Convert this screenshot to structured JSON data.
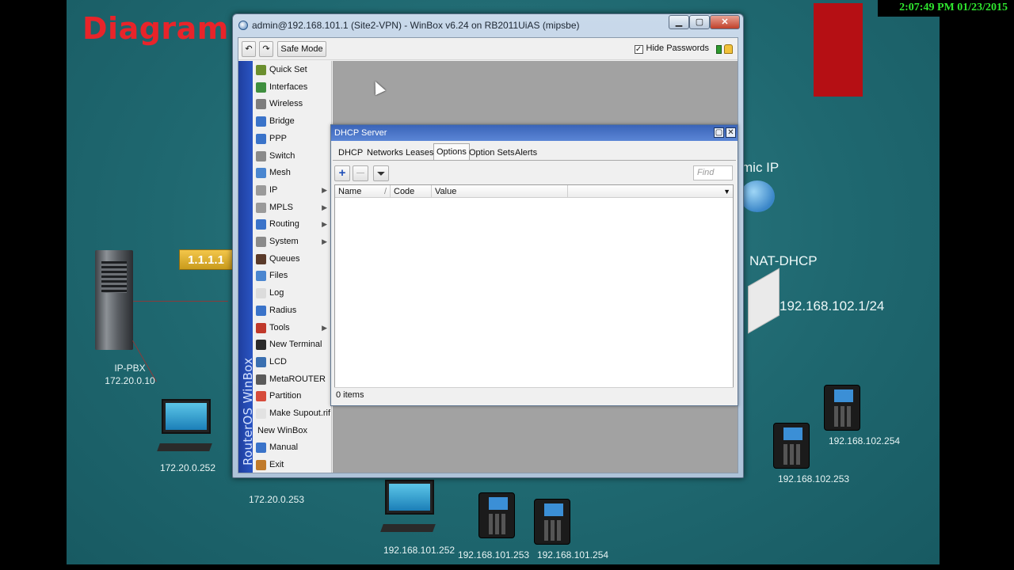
{
  "clock": "2:07:49 PM 01/23/2015",
  "diagram": {
    "title": "Diagram V",
    "ip_badge": "1.1.1.1",
    "server_label": "IP-PBX",
    "server_ip": "172.20.0.10",
    "pc1_ip": "172.20.0.252",
    "pc2_ip": "172.20.0.253",
    "pc3_ip": "192.168.101.252",
    "phone1_ip": "192.168.101.253",
    "phone2_ip": "192.168.101.254",
    "phone3_ip": "192.168.102.253",
    "phone4_ip": "192.168.102.254",
    "right_partial": "mic IP",
    "nat_label": "NAT-DHCP",
    "gateway": "192.168.102.1/24"
  },
  "winbox": {
    "title": "admin@192.168.101.1 (Site2-VPN) - WinBox v6.24 on RB2011UiAS (mipsbe)",
    "controls": {
      "minimize": "▁",
      "maximize": "▢",
      "close": "✕"
    },
    "toolbar": {
      "undo": "↶",
      "redo": "↷",
      "safe_mode": "Safe Mode",
      "hide_passwords": "Hide Passwords",
      "hide_passwords_checked": "✓"
    },
    "side_label": "RouterOS WinBox",
    "menu": [
      {
        "label": "Quick Set",
        "icon": "quick-set-icon",
        "color": "#6b8f2f",
        "arrow": ""
      },
      {
        "label": "Interfaces",
        "icon": "interfaces-icon",
        "color": "#3f8f3f",
        "arrow": ""
      },
      {
        "label": "Wireless",
        "icon": "wireless-icon",
        "color": "#7d7d7d",
        "arrow": ""
      },
      {
        "label": "Bridge",
        "icon": "bridge-icon",
        "color": "#3a73c9",
        "arrow": ""
      },
      {
        "label": "PPP",
        "icon": "ppp-icon",
        "color": "#3a73c9",
        "arrow": ""
      },
      {
        "label": "Switch",
        "icon": "switch-icon",
        "color": "#8a8a8a",
        "arrow": ""
      },
      {
        "label": "Mesh",
        "icon": "mesh-icon",
        "color": "#4a86d0",
        "arrow": ""
      },
      {
        "label": "IP",
        "icon": "ip-icon",
        "color": "#9a9a9a",
        "arrow": "▶"
      },
      {
        "label": "MPLS",
        "icon": "mpls-icon",
        "color": "#9a9a9a",
        "arrow": "▶"
      },
      {
        "label": "Routing",
        "icon": "routing-icon",
        "color": "#3a73c9",
        "arrow": "▶"
      },
      {
        "label": "System",
        "icon": "system-icon",
        "color": "#8a8a8a",
        "arrow": "▶"
      },
      {
        "label": "Queues",
        "icon": "queues-icon",
        "color": "#5a3a2a",
        "arrow": ""
      },
      {
        "label": "Files",
        "icon": "files-icon",
        "color": "#4a86d0",
        "arrow": ""
      },
      {
        "label": "Log",
        "icon": "log-icon",
        "color": "#dcdcdc",
        "arrow": ""
      },
      {
        "label": "Radius",
        "icon": "radius-icon",
        "color": "#3a73c9",
        "arrow": ""
      },
      {
        "label": "Tools",
        "icon": "tools-icon",
        "color": "#c0392b",
        "arrow": "▶"
      },
      {
        "label": "New Terminal",
        "icon": "terminal-icon",
        "color": "#2b2b2b",
        "arrow": ""
      },
      {
        "label": "LCD",
        "icon": "lcd-icon",
        "color": "#3a6fb0",
        "arrow": ""
      },
      {
        "label": "MetaROUTER",
        "icon": "metarouter-icon",
        "color": "#5a5a5a",
        "arrow": ""
      },
      {
        "label": "Partition",
        "icon": "partition-icon",
        "color": "#d64b3b",
        "arrow": ""
      },
      {
        "label": "Make Supout.rif",
        "icon": "supout-icon",
        "color": "#e2e2e2",
        "arrow": ""
      },
      {
        "label": "New WinBox",
        "icon": "",
        "color": "",
        "arrow": ""
      },
      {
        "label": "Manual",
        "icon": "manual-icon",
        "color": "#3a73c9",
        "arrow": ""
      },
      {
        "label": "Exit",
        "icon": "exit-icon",
        "color": "#c07a2a",
        "arrow": ""
      }
    ]
  },
  "dhcp_window": {
    "title": "DHCP Server",
    "controls": {
      "maximize": "▢",
      "close": "✕"
    },
    "tabs": [
      "DHCP",
      "Networks",
      "Leases",
      "Options",
      "Option Sets",
      "Alerts"
    ],
    "active_tab": "Options",
    "toolbar": {
      "add": "+",
      "remove": "—",
      "filter": "⏷"
    },
    "find_placeholder": "Find",
    "columns": [
      "Name",
      "Code",
      "Value"
    ],
    "sort_indicator": "/",
    "column_menu": "▼",
    "rows": [],
    "status": "0 items"
  }
}
